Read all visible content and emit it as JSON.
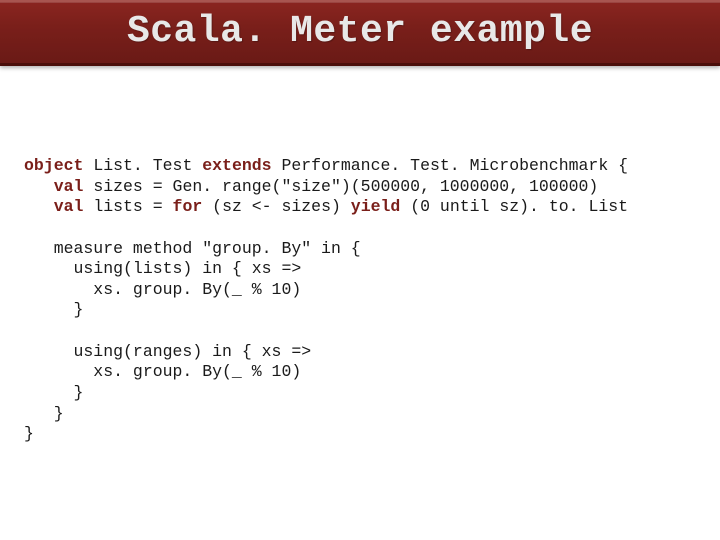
{
  "title": "Scala. Meter example",
  "code": {
    "l1a": "object",
    "l1b": " List. Test ",
    "l1c": "extends",
    "l1d": " Performance. Test. Microbenchmark {",
    "l2a": "   val",
    "l2b": " sizes = Gen. range(\"size\")(500000, 1000000, 100000)",
    "l3a": "   val",
    "l3b": " lists = ",
    "l3c": "for",
    "l3d": " (sz <- sizes) ",
    "l3e": "yield",
    "l3f": " (0 until sz). to. List",
    "l4": "",
    "l5": "   measure method \"group. By\" in {",
    "l6": "     using(lists) in { xs =>",
    "l7": "       xs. group. By(_ % 10)",
    "l8": "     }",
    "l9": "",
    "l10": "     using(ranges) in { xs =>",
    "l11": "       xs. group. By(_ % 10)",
    "l12": "     }",
    "l13": "   }",
    "l14": "}"
  }
}
